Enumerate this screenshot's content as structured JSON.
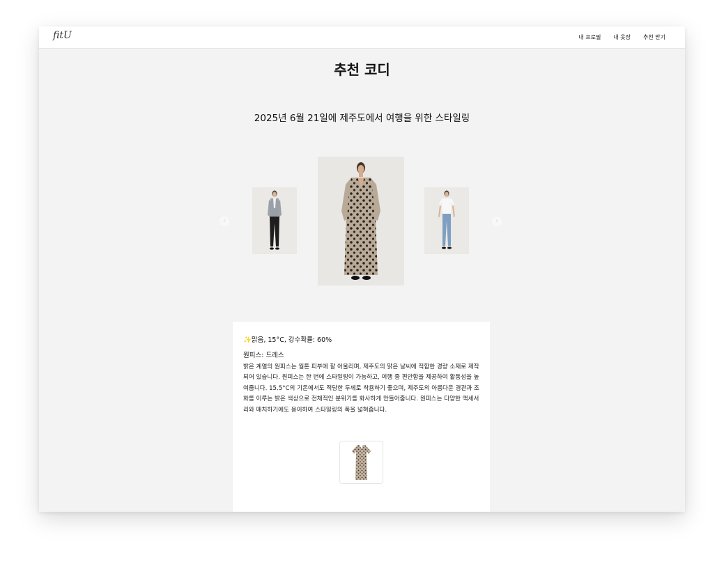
{
  "app": {
    "logo": "fitU"
  },
  "nav": {
    "links": [
      "내 프로필",
      "내 옷장",
      "추천 받기"
    ]
  },
  "page": {
    "title": "추천 코디",
    "subtitle": "2025년 6월 21일에 제주도에서 여행을 위한 스타일링"
  },
  "carousel": {
    "prev_icon": "‹",
    "next_icon": "›",
    "images": [
      {
        "name": "outfit-left",
        "desc": "gray cardigan and black pants"
      },
      {
        "name": "outfit-center",
        "desc": "beige polka-dot maxi dress"
      },
      {
        "name": "outfit-right",
        "desc": "white t-shirt and blue jeans"
      }
    ]
  },
  "detail": {
    "sparkle": "✨",
    "weather": "맑음, 15°C, 강수확률: 60%",
    "item_title": "원피스: 드레스",
    "description": "밝은 계열의 원피스는 웜톤 피부에 잘 어울리며, 제주도의 맑은 날씨에 적합한 경량 소재로 제작되어 있습니다. 원피스는 한 번에 스타일링이 가능하고, 여행 중 편안함을 제공하여 활동성을 높여줍니다. 15.5°C의 기온에서도 적당한 두께로 착용하기 좋으며, 제주도의 아름다운 경관과 조화를 이루는 밝은 색상으로 전체적인 분위기를 화사하게 만들어줍니다. 원피스는 다양한 액세서리와 매치하기에도 용이하여 스타일링의 폭을 넓혀줍니다."
  },
  "colors": {
    "background": "#f3f3f3",
    "card": "#ffffff",
    "dress": "#b9aa98"
  }
}
